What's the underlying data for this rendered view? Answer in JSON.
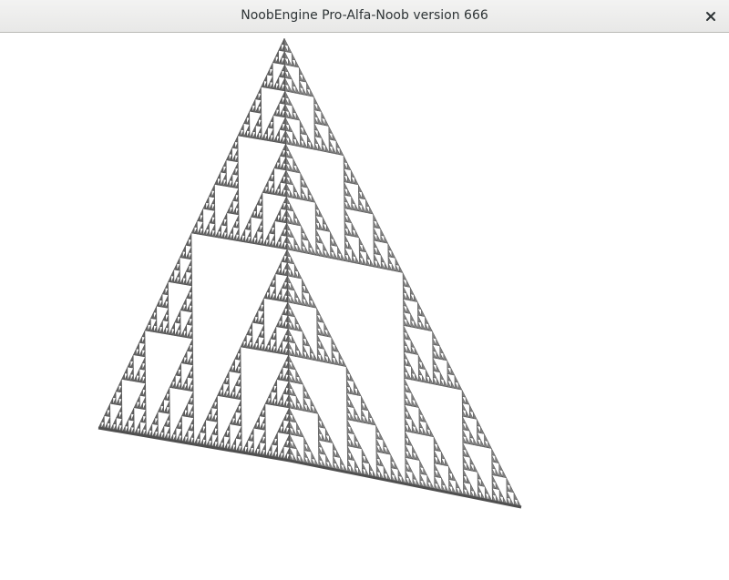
{
  "window": {
    "title": "NoobEngine Pro-Alfa-Noob version 666",
    "close_icon": "close-icon"
  },
  "scene": {
    "object": "sierpinski-tetrahedron",
    "background_color": "#ffffff",
    "colors": {
      "dark_face": "#4a4a4a",
      "mid_face": "#6e6e6e",
      "light_face": "#8e8e8e"
    }
  }
}
